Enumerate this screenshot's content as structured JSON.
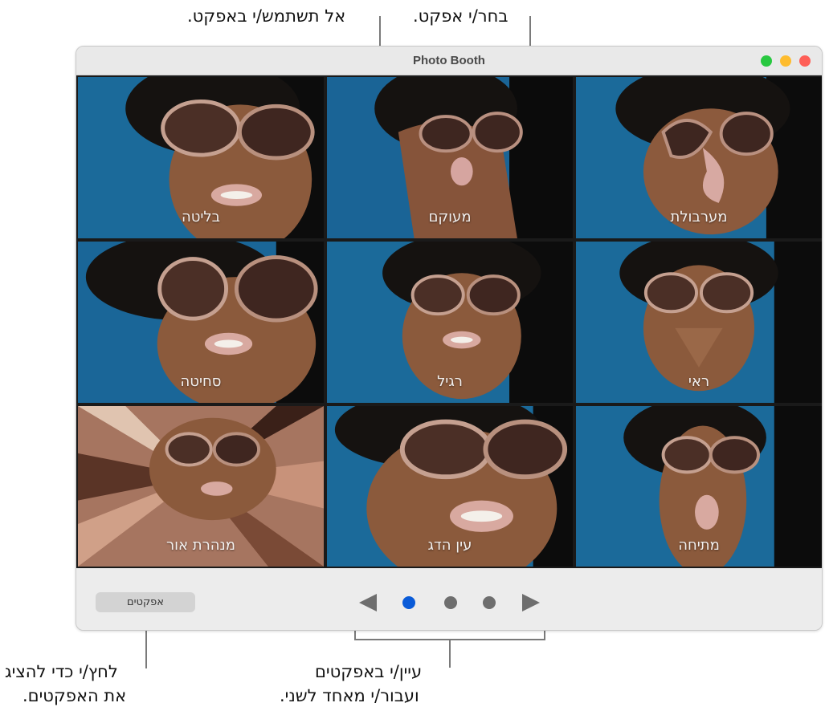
{
  "window": {
    "title": "Photo Booth"
  },
  "callouts": {
    "choose_effect": "בחר/י אפקט.",
    "no_effect": "אל תשתמש/י באפקט.",
    "browse_line1": "עיין/י באפקטים",
    "browse_line2": "ועבור/י מאחד לשני.",
    "click_line1": "לחץ/י כדי להציג",
    "click_line2": "את האפקטים."
  },
  "effects": [
    {
      "label": "בליטה"
    },
    {
      "label": "מעוקם"
    },
    {
      "label": "מערבולת"
    },
    {
      "label": "סחיטה"
    },
    {
      "label": "רגיל"
    },
    {
      "label": "ראי"
    },
    {
      "label": "מנהרת אור"
    },
    {
      "label": "עין הדג"
    },
    {
      "label": "מתיחה"
    }
  ],
  "toolbar": {
    "effects_button": "אפקטים",
    "page_count": 3,
    "current_page": 1
  },
  "colors": {
    "active_dot": "#0a5bd8",
    "inactive_dot": "#6e6e6e",
    "close": "#fe5f57",
    "minimize": "#febc2e",
    "zoom": "#28c840"
  }
}
